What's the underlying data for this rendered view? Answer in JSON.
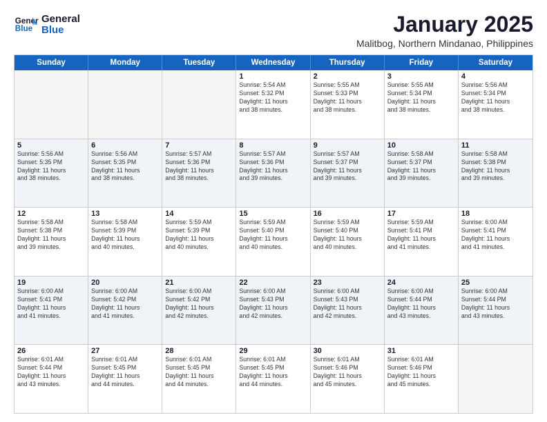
{
  "logo": {
    "line1": "General",
    "line2": "Blue"
  },
  "title": "January 2025",
  "location": "Malitbog, Northern Mindanao, Philippines",
  "header": {
    "days": [
      "Sunday",
      "Monday",
      "Tuesday",
      "Wednesday",
      "Thursday",
      "Friday",
      "Saturday"
    ]
  },
  "rows": [
    {
      "alt": false,
      "cells": [
        {
          "day": "",
          "info": ""
        },
        {
          "day": "",
          "info": ""
        },
        {
          "day": "",
          "info": ""
        },
        {
          "day": "1",
          "info": "Sunrise: 5:54 AM\nSunset: 5:32 PM\nDaylight: 11 hours\nand 38 minutes."
        },
        {
          "day": "2",
          "info": "Sunrise: 5:55 AM\nSunset: 5:33 PM\nDaylight: 11 hours\nand 38 minutes."
        },
        {
          "day": "3",
          "info": "Sunrise: 5:55 AM\nSunset: 5:34 PM\nDaylight: 11 hours\nand 38 minutes."
        },
        {
          "day": "4",
          "info": "Sunrise: 5:56 AM\nSunset: 5:34 PM\nDaylight: 11 hours\nand 38 minutes."
        }
      ]
    },
    {
      "alt": true,
      "cells": [
        {
          "day": "5",
          "info": "Sunrise: 5:56 AM\nSunset: 5:35 PM\nDaylight: 11 hours\nand 38 minutes."
        },
        {
          "day": "6",
          "info": "Sunrise: 5:56 AM\nSunset: 5:35 PM\nDaylight: 11 hours\nand 38 minutes."
        },
        {
          "day": "7",
          "info": "Sunrise: 5:57 AM\nSunset: 5:36 PM\nDaylight: 11 hours\nand 38 minutes."
        },
        {
          "day": "8",
          "info": "Sunrise: 5:57 AM\nSunset: 5:36 PM\nDaylight: 11 hours\nand 39 minutes."
        },
        {
          "day": "9",
          "info": "Sunrise: 5:57 AM\nSunset: 5:37 PM\nDaylight: 11 hours\nand 39 minutes."
        },
        {
          "day": "10",
          "info": "Sunrise: 5:58 AM\nSunset: 5:37 PM\nDaylight: 11 hours\nand 39 minutes."
        },
        {
          "day": "11",
          "info": "Sunrise: 5:58 AM\nSunset: 5:38 PM\nDaylight: 11 hours\nand 39 minutes."
        }
      ]
    },
    {
      "alt": false,
      "cells": [
        {
          "day": "12",
          "info": "Sunrise: 5:58 AM\nSunset: 5:38 PM\nDaylight: 11 hours\nand 39 minutes."
        },
        {
          "day": "13",
          "info": "Sunrise: 5:58 AM\nSunset: 5:39 PM\nDaylight: 11 hours\nand 40 minutes."
        },
        {
          "day": "14",
          "info": "Sunrise: 5:59 AM\nSunset: 5:39 PM\nDaylight: 11 hours\nand 40 minutes."
        },
        {
          "day": "15",
          "info": "Sunrise: 5:59 AM\nSunset: 5:40 PM\nDaylight: 11 hours\nand 40 minutes."
        },
        {
          "day": "16",
          "info": "Sunrise: 5:59 AM\nSunset: 5:40 PM\nDaylight: 11 hours\nand 40 minutes."
        },
        {
          "day": "17",
          "info": "Sunrise: 5:59 AM\nSunset: 5:41 PM\nDaylight: 11 hours\nand 41 minutes."
        },
        {
          "day": "18",
          "info": "Sunrise: 6:00 AM\nSunset: 5:41 PM\nDaylight: 11 hours\nand 41 minutes."
        }
      ]
    },
    {
      "alt": true,
      "cells": [
        {
          "day": "19",
          "info": "Sunrise: 6:00 AM\nSunset: 5:41 PM\nDaylight: 11 hours\nand 41 minutes."
        },
        {
          "day": "20",
          "info": "Sunrise: 6:00 AM\nSunset: 5:42 PM\nDaylight: 11 hours\nand 41 minutes."
        },
        {
          "day": "21",
          "info": "Sunrise: 6:00 AM\nSunset: 5:42 PM\nDaylight: 11 hours\nand 42 minutes."
        },
        {
          "day": "22",
          "info": "Sunrise: 6:00 AM\nSunset: 5:43 PM\nDaylight: 11 hours\nand 42 minutes."
        },
        {
          "day": "23",
          "info": "Sunrise: 6:00 AM\nSunset: 5:43 PM\nDaylight: 11 hours\nand 42 minutes."
        },
        {
          "day": "24",
          "info": "Sunrise: 6:00 AM\nSunset: 5:44 PM\nDaylight: 11 hours\nand 43 minutes."
        },
        {
          "day": "25",
          "info": "Sunrise: 6:00 AM\nSunset: 5:44 PM\nDaylight: 11 hours\nand 43 minutes."
        }
      ]
    },
    {
      "alt": false,
      "cells": [
        {
          "day": "26",
          "info": "Sunrise: 6:01 AM\nSunset: 5:44 PM\nDaylight: 11 hours\nand 43 minutes."
        },
        {
          "day": "27",
          "info": "Sunrise: 6:01 AM\nSunset: 5:45 PM\nDaylight: 11 hours\nand 44 minutes."
        },
        {
          "day": "28",
          "info": "Sunrise: 6:01 AM\nSunset: 5:45 PM\nDaylight: 11 hours\nand 44 minutes."
        },
        {
          "day": "29",
          "info": "Sunrise: 6:01 AM\nSunset: 5:45 PM\nDaylight: 11 hours\nand 44 minutes."
        },
        {
          "day": "30",
          "info": "Sunrise: 6:01 AM\nSunset: 5:46 PM\nDaylight: 11 hours\nand 45 minutes."
        },
        {
          "day": "31",
          "info": "Sunrise: 6:01 AM\nSunset: 5:46 PM\nDaylight: 11 hours\nand 45 minutes."
        },
        {
          "day": "",
          "info": ""
        }
      ]
    }
  ]
}
